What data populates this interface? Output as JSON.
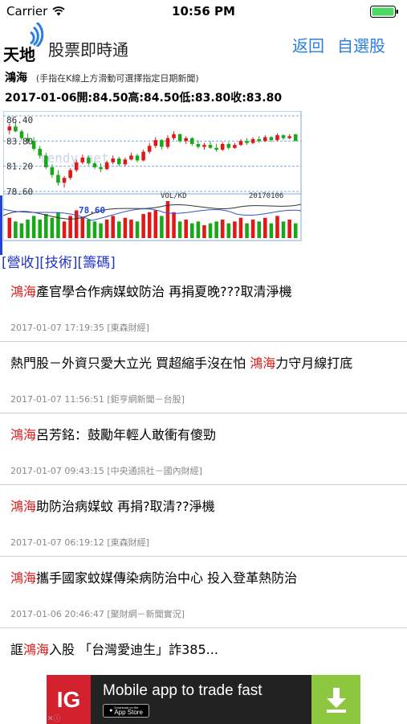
{
  "status": {
    "carrier": "Carrier",
    "time": "10:56 PM"
  },
  "nav": {
    "logo": "天地",
    "title": "股票即時通",
    "back": "返回",
    "favorites": "自選股"
  },
  "stock": {
    "name": "鴻海",
    "hint": "(手指在K線上方滑動可選擇指定日期新聞)",
    "ohlc": "2017-01-06開:84.50高:84.50低:83.80收:83.80"
  },
  "chart": {
    "y_labels": [
      "86.40",
      "83.80",
      "81.20",
      "78.60"
    ],
    "volume_label": "VOL/KD",
    "date_label": "20170106",
    "watermark": "tendy.net",
    "price_line_label": "78.60",
    "colors": {
      "up": "#e01818",
      "down": "#18a818",
      "grid": "#7fa7d6"
    }
  },
  "chart_data": {
    "type": "candlestick",
    "ylim": [
      78.6,
      86.4
    ],
    "y_ticks": [
      86.4,
      83.8,
      81.2,
      78.6
    ],
    "latest": {
      "date": "20170106",
      "open": 84.5,
      "high": 84.5,
      "low": 83.8,
      "close": 83.8
    },
    "candles": [
      [
        84.9,
        85.6,
        84.5,
        85.3
      ],
      [
        85.3,
        85.8,
        84.7,
        84.8
      ],
      [
        84.8,
        85.0,
        83.9,
        84.1
      ],
      [
        84.1,
        84.6,
        83.5,
        83.8
      ],
      [
        83.8,
        84.2,
        82.8,
        83.0
      ],
      [
        83.0,
        83.3,
        82.0,
        82.3
      ],
      [
        82.3,
        82.6,
        80.9,
        81.1
      ],
      [
        81.1,
        81.4,
        80.0,
        80.3
      ],
      [
        80.3,
        80.8,
        79.2,
        79.5
      ],
      [
        79.5,
        80.2,
        79.0,
        80.0
      ],
      [
        80.0,
        81.0,
        79.8,
        80.8
      ],
      [
        80.8,
        81.9,
        80.6,
        81.6
      ],
      [
        81.6,
        82.4,
        81.4,
        82.1
      ],
      [
        82.1,
        82.3,
        81.3,
        81.5
      ],
      [
        81.5,
        81.7,
        80.9,
        81.1
      ],
      [
        81.1,
        81.5,
        80.6,
        80.9
      ],
      [
        80.9,
        81.8,
        80.8,
        81.6
      ],
      [
        81.6,
        82.3,
        81.4,
        82.0
      ],
      [
        82.0,
        82.2,
        81.2,
        81.4
      ],
      [
        81.4,
        82.1,
        81.2,
        81.9
      ],
      [
        81.9,
        82.6,
        81.8,
        82.3
      ],
      [
        82.3,
        82.5,
        81.6,
        81.8
      ],
      [
        81.8,
        82.9,
        81.7,
        82.7
      ],
      [
        82.7,
        83.6,
        82.5,
        83.3
      ],
      [
        83.3,
        84.2,
        83.1,
        83.9
      ],
      [
        83.9,
        84.0,
        82.9,
        83.2
      ],
      [
        83.2,
        84.4,
        83.0,
        84.1
      ],
      [
        84.1,
        84.8,
        83.9,
        84.5
      ],
      [
        84.5,
        84.6,
        83.6,
        83.8
      ],
      [
        83.8,
        84.3,
        83.5,
        84.1
      ],
      [
        84.1,
        84.2,
        83.3,
        83.5
      ],
      [
        83.5,
        83.9,
        83.0,
        83.2
      ],
      [
        83.2,
        83.6,
        82.9,
        83.4
      ],
      [
        83.4,
        83.8,
        83.0,
        83.1
      ],
      [
        83.1,
        83.5,
        82.7,
        82.9
      ],
      [
        82.9,
        83.7,
        82.8,
        83.5
      ],
      [
        83.5,
        83.7,
        82.9,
        83.1
      ],
      [
        83.1,
        83.6,
        83.0,
        83.4
      ],
      [
        83.4,
        84.0,
        83.3,
        83.8
      ],
      [
        83.8,
        84.1,
        83.4,
        83.6
      ],
      [
        83.6,
        84.2,
        83.5,
        84.0
      ],
      [
        84.0,
        84.3,
        83.6,
        83.8
      ],
      [
        83.8,
        84.4,
        83.7,
        84.2
      ],
      [
        84.2,
        84.3,
        83.7,
        83.9
      ],
      [
        83.9,
        84.6,
        83.8,
        84.4
      ],
      [
        84.4,
        84.5,
        83.9,
        84.1
      ],
      [
        84.1,
        84.5,
        84.0,
        84.3
      ],
      [
        84.5,
        84.5,
        83.8,
        83.8
      ]
    ],
    "volumes": [
      0.55,
      0.45,
      0.4,
      0.5,
      0.6,
      0.5,
      0.65,
      0.55,
      0.7,
      0.45,
      0.6,
      0.75,
      0.55,
      0.5,
      0.45,
      0.4,
      0.5,
      0.6,
      0.45,
      0.55,
      0.5,
      0.45,
      0.65,
      0.7,
      0.75,
      0.6,
      1.0,
      0.7,
      0.45,
      0.5,
      0.4,
      0.45,
      0.35,
      0.4,
      0.45,
      0.5,
      0.4,
      0.45,
      0.55,
      0.4,
      0.5,
      0.45,
      0.55,
      0.4,
      0.6,
      0.45,
      0.5,
      0.4
    ]
  },
  "links": [
    "[營收]",
    "[技術]",
    "[籌碼]"
  ],
  "news": [
    {
      "pre": "",
      "hl": "鴻海",
      "post": "產官學合作病媒蚊防治 再捐夏晚???取清淨機",
      "meta": "2017-01-07 17:19:35 [東森財經]"
    },
    {
      "pre": "熱門股－外資只愛大立光 買超縮手沒在怕 ",
      "hl": "鴻海",
      "post": "力守月線打底",
      "meta": "2017-01-07 11:56:51 [鉅亨網新聞－台股]"
    },
    {
      "pre": "",
      "hl": "鴻海",
      "post": "呂芳銘：鼓勵年輕人敢衝有傻勁",
      "meta": "2017-01-07 09:43:15 [中央通訊社－國內財經]"
    },
    {
      "pre": "",
      "hl": "鴻海",
      "post": "助防治病媒蚊 再捐?取清??淨機",
      "meta": "2017-01-07 06:19:12 [東森財經]"
    },
    {
      "pre": "",
      "hl": "鴻海",
      "post": "攜手國家蚊媒傳染病防治中心 投入登革熱防治",
      "meta": "2017-01-06 20:46:47 [聚財網－新聞實況]"
    },
    {
      "pre": "誆",
      "hl": "鴻海",
      "post": "入股 「台灣愛迪生」詐385...",
      "meta": ""
    }
  ],
  "ad": {
    "brand": "IG",
    "text": "Mobile app to trade fast",
    "store_small": "Download on the",
    "store_big": "App Store",
    "close": "✕ⓘ"
  }
}
